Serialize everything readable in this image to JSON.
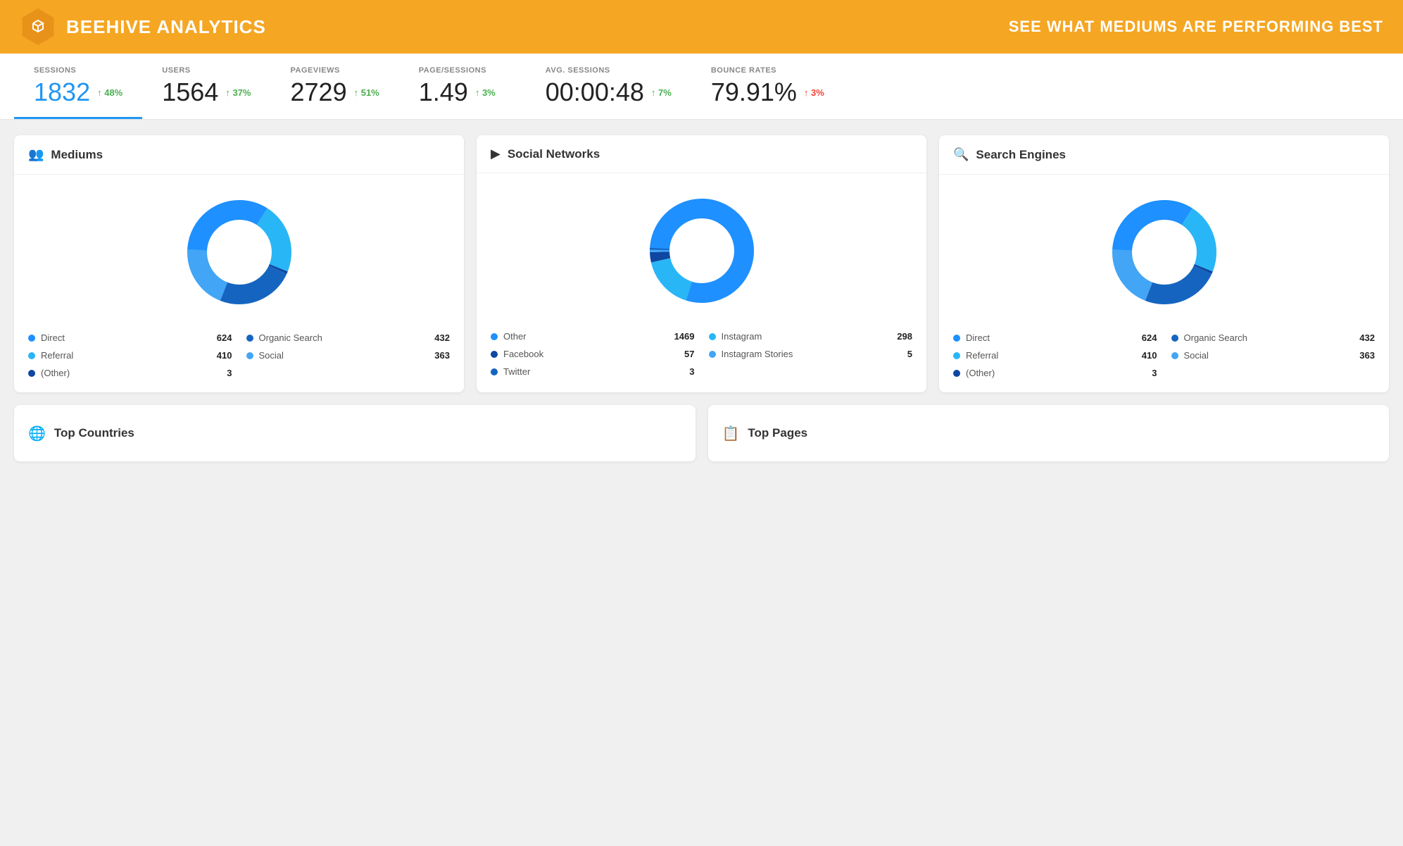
{
  "header": {
    "title": "BEEHIVE ANALYTICS",
    "subtitle": "SEE WHAT MEDIUMS ARE PERFORMING BEST",
    "logo_symbol": "⌂"
  },
  "stats": [
    {
      "key": "sessions",
      "label": "SESSIONS",
      "value": "1832",
      "change": "48%",
      "change_type": "up-green",
      "active": true
    },
    {
      "key": "users",
      "label": "USERS",
      "value": "1564",
      "change": "37%",
      "change_type": "up-green",
      "active": false
    },
    {
      "key": "pageviews",
      "label": "PAGEVIEWS",
      "value": "2729",
      "change": "51%",
      "change_type": "up-green",
      "active": false
    },
    {
      "key": "page_sessions",
      "label": "PAGE/SESSIONS",
      "value": "1.49",
      "change": "3%",
      "change_type": "up-green",
      "active": false
    },
    {
      "key": "avg_sessions",
      "label": "AVG. SESSIONS",
      "value": "00:00:48",
      "change": "7%",
      "change_type": "up-green",
      "active": false
    },
    {
      "key": "bounce_rates",
      "label": "BOUNCE RATES",
      "value": "79.91%",
      "change": "3%",
      "change_type": "up-red",
      "active": false
    }
  ],
  "mediums": {
    "title": "Mediums",
    "donut": {
      "segments": [
        {
          "label": "Direct",
          "value": 624,
          "color": "#1E90FF",
          "percent": 37
        },
        {
          "label": "Referral",
          "value": 410,
          "color": "#29B6F6",
          "percent": 25
        },
        {
          "label": "(Other)",
          "value": 3,
          "color": "#0D47A1",
          "percent": 1
        },
        {
          "label": "Organic Search",
          "value": 432,
          "color": "#1565C0",
          "percent": 26
        },
        {
          "label": "Social",
          "value": 363,
          "color": "#42A5F5",
          "percent": 22
        }
      ]
    },
    "legend": [
      {
        "label": "Direct",
        "value": "624",
        "color": "#1E90FF"
      },
      {
        "label": "Organic Search",
        "value": "432",
        "color": "#1565C0"
      },
      {
        "label": "Referral",
        "value": "410",
        "color": "#29B6F6"
      },
      {
        "label": "Social",
        "value": "363",
        "color": "#42A5F5"
      },
      {
        "label": "(Other)",
        "value": "3",
        "color": "#0D47A1"
      }
    ]
  },
  "social_networks": {
    "title": "Social Networks",
    "donut": {
      "segments": [
        {
          "label": "Other",
          "value": 1469,
          "color": "#1E90FF",
          "percent": 80
        },
        {
          "label": "Facebook",
          "value": 57,
          "color": "#0D47A1",
          "percent": 5
        },
        {
          "label": "Twitter",
          "value": 3,
          "color": "#1565C0",
          "percent": 1
        },
        {
          "label": "Instagram",
          "value": 298,
          "color": "#29B6F6",
          "percent": 16
        },
        {
          "label": "Instagram Stories",
          "value": 5,
          "color": "#42A5F5",
          "percent": 1
        }
      ]
    },
    "legend": [
      {
        "label": "Other",
        "value": "1469",
        "color": "#1E90FF"
      },
      {
        "label": "Instagram",
        "value": "298",
        "color": "#29B6F6"
      },
      {
        "label": "Facebook",
        "value": "57",
        "color": "#0D47A1"
      },
      {
        "label": "Instagram Stories",
        "value": "5",
        "color": "#42A5F5"
      },
      {
        "label": "Twitter",
        "value": "3",
        "color": "#1565C0"
      }
    ]
  },
  "search_engines": {
    "title": "Search Engines",
    "donut": {
      "segments": [
        {
          "label": "Direct",
          "value": 624,
          "color": "#1E90FF",
          "percent": 37
        },
        {
          "label": "Referral",
          "value": 410,
          "color": "#29B6F6",
          "percent": 25
        },
        {
          "label": "(Other)",
          "value": 3,
          "color": "#0D47A1",
          "percent": 1
        },
        {
          "label": "Organic Search",
          "value": 432,
          "color": "#1565C0",
          "percent": 26
        },
        {
          "label": "Social",
          "value": 363,
          "color": "#42A5F5",
          "percent": 22
        }
      ]
    },
    "legend": [
      {
        "label": "Direct",
        "value": "624",
        "color": "#1E90FF"
      },
      {
        "label": "Organic Search",
        "value": "432",
        "color": "#1565C0"
      },
      {
        "label": "Referral",
        "value": "410",
        "color": "#29B6F6"
      },
      {
        "label": "Social",
        "value": "363",
        "color": "#42A5F5"
      },
      {
        "label": "(Other)",
        "value": "3",
        "color": "#0D47A1"
      }
    ]
  },
  "bottom": {
    "top_countries_label": "Top Countries",
    "top_pages_label": "Top Pages"
  }
}
